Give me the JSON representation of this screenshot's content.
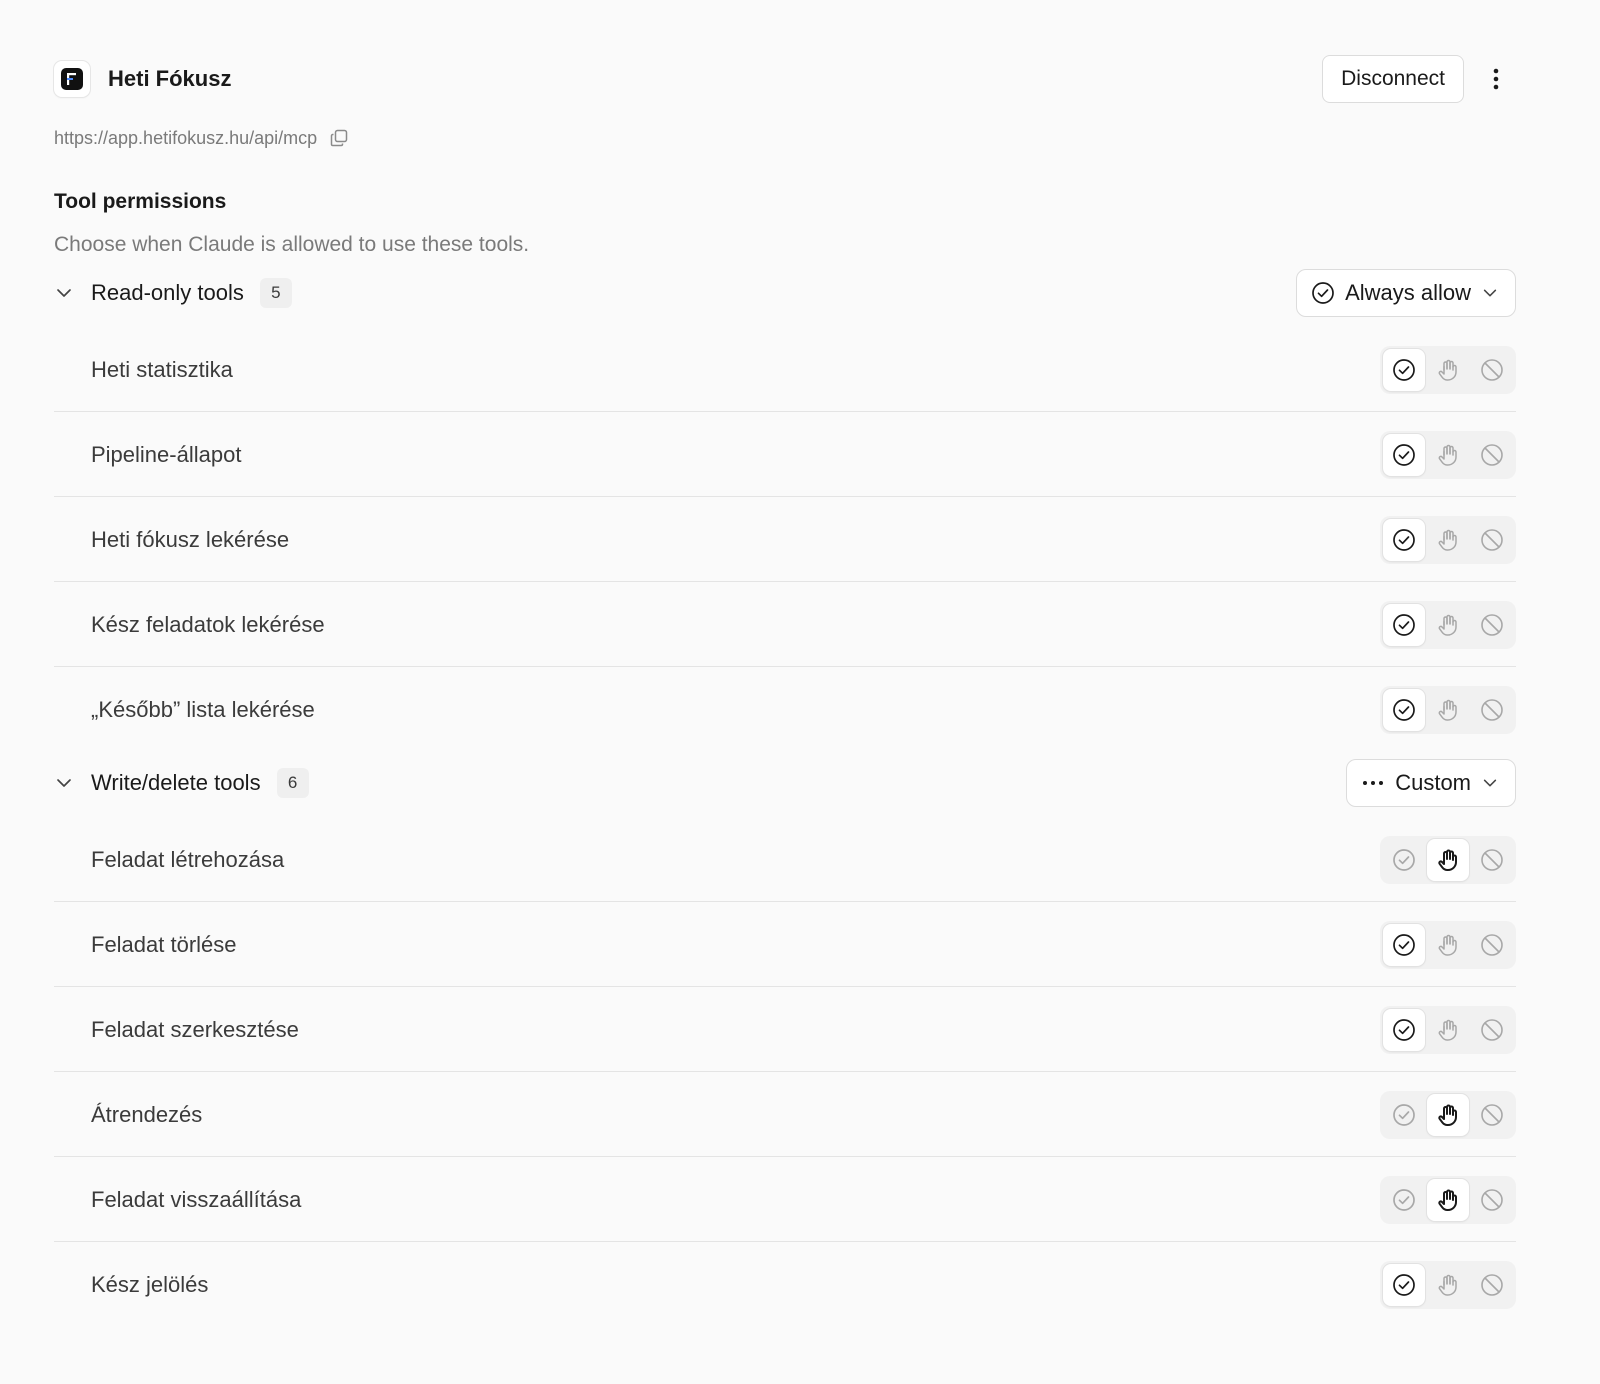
{
  "connector": {
    "name": "Heti Fókusz",
    "url": "https://app.hetifokusz.hu/api/mcp",
    "disconnect_label": "Disconnect"
  },
  "permissions": {
    "title": "Tool permissions",
    "description": "Choose when Claude is allowed to use these tools."
  },
  "groups": [
    {
      "label": "Read-only tools",
      "count": "5",
      "policy_label": "Always allow",
      "policy_icon": "check-circle-icon",
      "tools": [
        {
          "name": "Heti statisztika",
          "state": "allow"
        },
        {
          "name": "Pipeline-állapot",
          "state": "allow"
        },
        {
          "name": "Heti fókusz lekérése",
          "state": "allow"
        },
        {
          "name": "Kész feladatok lekérése",
          "state": "allow"
        },
        {
          "name": "„Később” lista lekérése",
          "state": "allow"
        }
      ]
    },
    {
      "label": "Write/delete tools",
      "count": "6",
      "policy_label": "Custom",
      "policy_icon": "ellipsis-icon",
      "tools": [
        {
          "name": "Feladat létrehozása",
          "state": "ask"
        },
        {
          "name": "Feladat törlése",
          "state": "allow"
        },
        {
          "name": "Feladat szerkesztése",
          "state": "allow"
        },
        {
          "name": "Átrendezés",
          "state": "ask"
        },
        {
          "name": "Feladat visszaállítása",
          "state": "ask"
        },
        {
          "name": "Kész jelölés",
          "state": "allow"
        }
      ]
    }
  ]
}
